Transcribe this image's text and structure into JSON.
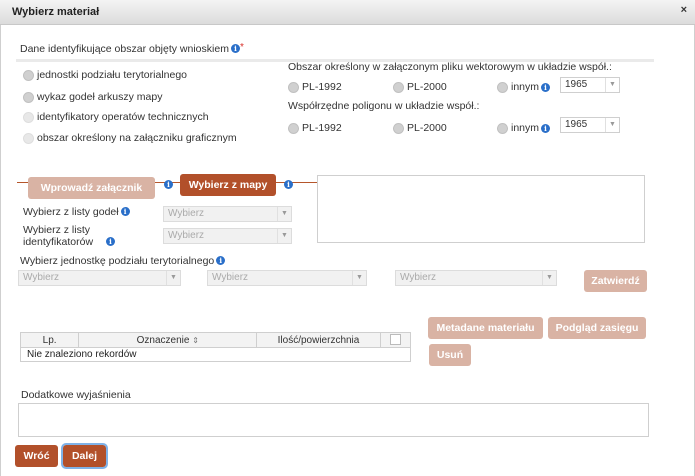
{
  "window": {
    "title": "Wybierz materiał",
    "close_glyph": "×"
  },
  "section1": {
    "heading": "Dane identyfikujące obszar objęty wnioskiem",
    "required_mark": "*",
    "options": [
      "jednostki podziału terytorialnego",
      "wykaz godeł arkuszy mapy",
      "identyfikatory operatów technicznych",
      "obszar określony na załączniku graficznym"
    ]
  },
  "vector": {
    "heading": "Obszar określony w załączonym pliku wektorowym w układzie współ.:",
    "options": [
      "PL-1992",
      "PL-2000",
      "innym"
    ],
    "year_value": "1965"
  },
  "polygon": {
    "heading": "Współrzędne poligonu w układzie współ.:",
    "options": [
      "PL-1992",
      "PL-2000",
      "innym"
    ],
    "year_value": "1965"
  },
  "attach": {
    "upload_button": "Wprowadź załącznik",
    "map_button": "Wybierz z mapy"
  },
  "lists": {
    "godla_label": "Wybierz z listy godeł",
    "godla_value": "Wybierz",
    "ident_label": "Wybierz z listy identyfikatorów",
    "ident_value": "Wybierz"
  },
  "territorial": {
    "label": "Wybierz jednostkę podziału terytorialnego",
    "selects": [
      "Wybierz",
      "Wybierz",
      "Wybierz"
    ],
    "confirm_button": "Zatwierdź"
  },
  "table": {
    "columns": [
      "Lp.",
      "Oznaczenie",
      "Ilość/powierzchnia"
    ],
    "sort_glyph": "⇕",
    "empty_message": "Nie znaleziono rekordów"
  },
  "actions": {
    "metadata_button": "Metadane materiału",
    "preview_button": "Podgląd zasięgu",
    "delete_button": "Usuń"
  },
  "notes": {
    "label": "Dodatkowe wyjaśnienia"
  },
  "footer": {
    "back_button": "Wróć",
    "next_button": "Dalej"
  },
  "colors": {
    "accent": "#b2502a",
    "accent_disabled": "#d9b3a4",
    "info": "#2a6fc9",
    "required": "#d9312b"
  },
  "icons": {
    "info": "info-icon",
    "close": "close-icon",
    "dropdown": "chevron-down-icon",
    "sort": "sort-icon"
  }
}
